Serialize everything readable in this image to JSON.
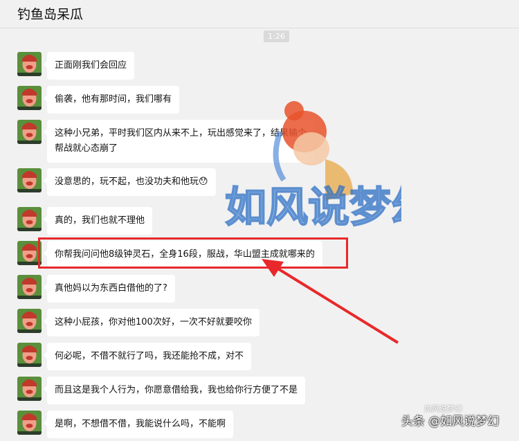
{
  "window": {
    "title": "钓鱼岛呆瓜"
  },
  "time_divider": "1:26",
  "messages": [
    {
      "text": "正面刚我们会回应"
    },
    {
      "text": "偷袭，他有那时间，我们哪有"
    },
    {
      "text": "这种小兄弟，平时我们区内从来不上，玩出感觉来了，结果输个\n帮战就心态崩了"
    },
    {
      "text": "没意思的，玩不起，也没功夫和他玩😯"
    },
    {
      "text": "真的，我们也就不理他"
    },
    {
      "text": "你帮我问问他8级钟灵石，全身16段，服战，华山盟主成就哪来的"
    },
    {
      "text": "真他妈以为东西白借他的了?"
    },
    {
      "text": "这种小屁孩，你对他100次好，一次不好就要咬你"
    },
    {
      "text": "何必呢，不借不就行了吗，我还能抢不成，对不"
    },
    {
      "text": "而且这是我个人行为，你愿意借给我，我也给你行方便了不是"
    },
    {
      "text": "是啊，不想借不借，我能说什么吗，不能啊"
    }
  ],
  "watermark": {
    "text": "如风说梦幻"
  },
  "footer": {
    "brand": "头条 @如风说梦幻",
    "small": "如风说梦幻"
  },
  "colors": {
    "highlight": "#e8282b",
    "bubble": "#ffffff",
    "background": "#f1f1f1"
  }
}
